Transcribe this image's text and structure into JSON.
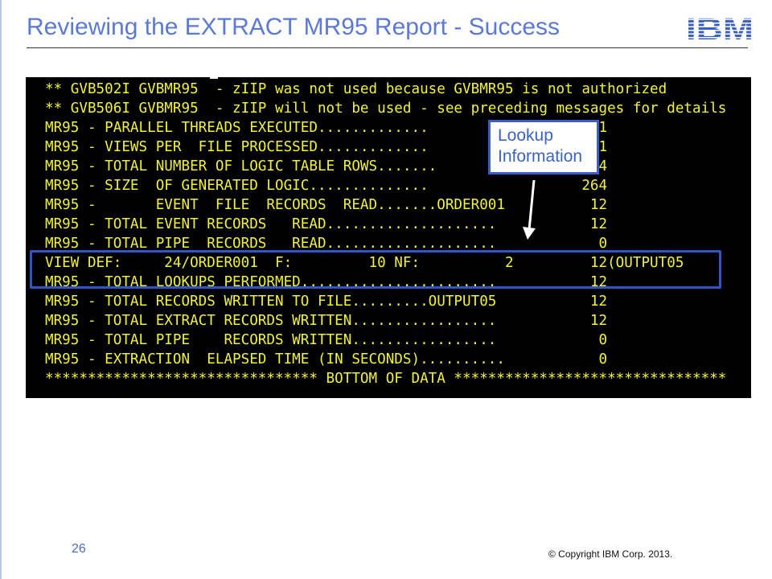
{
  "slide": {
    "title": "Reviewing the EXTRACT MR95 Report - Success",
    "logo_text": "IBM",
    "page_number": "26",
    "copyright": "© Copyright  IBM Corp. 2013."
  },
  "colors": {
    "title": "#5b79d6",
    "terminal_background": "#000000",
    "terminal_text": "#f2f23c",
    "highlight_border": "#2f56c6",
    "logo": "#3a5fc8"
  },
  "callout": {
    "line1": "Lookup",
    "line2": "Information"
  },
  "terminal": {
    "lines": [
      "** GVB502I GVBMR95  - zIIP was not used because GVBMR95 is not authorized",
      "** GVB506I GVBMR95  - zIIP will not be used - see preceding messages for details",
      "MR95 - PARALLEL THREADS EXECUTED.............                    1",
      "MR95 - VIEWS PER  FILE PROCESSED.............                    1",
      "MR95 - TOTAL NUMBER OF LOGIC TABLE ROWS.......                  14",
      "MR95 - SIZE  OF GENERATED LOGIC..............                  264",
      "MR95 -       EVENT  FILE  RECORDS  READ.......ORDER001          12",
      "MR95 - TOTAL EVENT RECORDS   READ....................           12",
      "MR95 - TOTAL PIPE  RECORDS   READ....................            0",
      "VIEW DEF:     24/ORDER001  F:         10 NF:          2         12(OUTPUT05",
      "MR95 - TOTAL LOOKUPS PERFORMED.......................           12",
      "MR95 - TOTAL RECORDS WRITTEN TO FILE.........OUTPUT05           12",
      "MR95 - TOTAL EXTRACT RECORDS WRITTEN.................           12",
      "MR95 - TOTAL PIPE    RECORDS WRITTEN.................            0",
      "MR95 - EXTRACTION  ELAPSED TIME (IN SECONDS)..........           0",
      "******************************** BOTTOM OF DATA ********************************"
    ]
  }
}
